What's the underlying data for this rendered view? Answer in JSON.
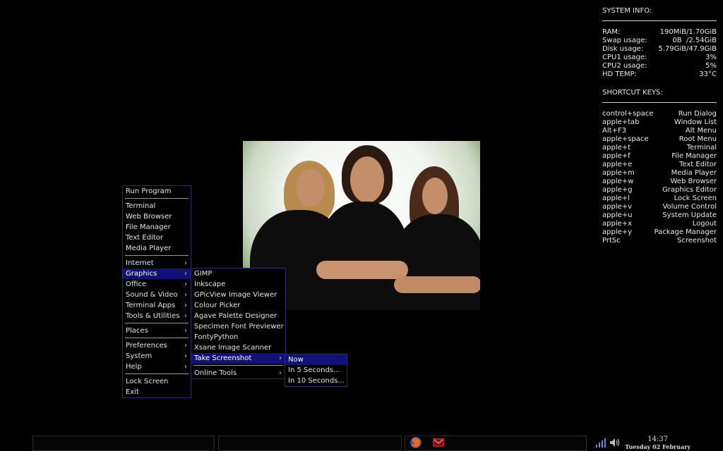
{
  "conky": {
    "system_title": "SYSTEM INFO:",
    "stats": [
      {
        "label": "RAM:",
        "value": "190MiB/1.70GiB"
      },
      {
        "label": "Swap usage:",
        "value": "0B  /2.54GiB"
      },
      {
        "label": "Disk usage:",
        "value": "5.79GiB/47.9GiB"
      },
      {
        "label": "CPU1 usage:",
        "value": "3%"
      },
      {
        "label": "CPU2 usage:",
        "value": "5%"
      },
      {
        "label": "HD TEMP:",
        "value": "33°C"
      }
    ],
    "shortcut_title": "SHORTCUT KEYS:",
    "shortcuts": [
      {
        "key": "control+space",
        "action": "Run Dialog"
      },
      {
        "key": "apple+tab",
        "action": "Window List"
      },
      {
        "key": "Alt+F3",
        "action": "Alt Menu"
      },
      {
        "key": "apple+space",
        "action": "Root Menu"
      },
      {
        "key": "apple+t",
        "action": "Terminal"
      },
      {
        "key": "apple+f",
        "action": "File Manager"
      },
      {
        "key": "apple+e",
        "action": "Text Editor"
      },
      {
        "key": "apple+m",
        "action": "Media Player"
      },
      {
        "key": "apple+w",
        "action": "Web Browser"
      },
      {
        "key": "apple+g",
        "action": "Graphics Editor"
      },
      {
        "key": "apple+l",
        "action": "Lock Screen"
      },
      {
        "key": "apple+v",
        "action": "Volume Control"
      },
      {
        "key": "apple+u",
        "action": "System Update"
      },
      {
        "key": "apple+x",
        "action": "Logout"
      },
      {
        "key": "apple+y",
        "action": "Package Manager"
      },
      {
        "key": "PrtSc",
        "action": "Screenshot"
      }
    ]
  },
  "root_menu": {
    "run_program": "Run Program",
    "apps": [
      "Terminal",
      "Web Browser",
      "File Manager",
      "Text Editor",
      "Media Player"
    ],
    "categories": [
      "Internet",
      "Graphics",
      "Office",
      "Sound & Video",
      "Terminal Apps",
      "Tools & Utilities"
    ],
    "places": "Places",
    "system_items": [
      "Preferences",
      "System",
      "Help"
    ],
    "lock": "Lock Screen",
    "exit": "Exit"
  },
  "graphics_menu": {
    "items": [
      "GIMP",
      "Inkscape",
      "GPicView Image Viewer",
      "Colour Picker",
      "Agave Palette Designer",
      "Specimen Font Previewer",
      "FontyPython",
      "Xsane Image Scanner"
    ],
    "take_screenshot": "Take Screenshot",
    "online_tools": "Online Tools"
  },
  "screenshot_menu": {
    "items": [
      "Now",
      "In 5 Seconds...",
      "In 10 Seconds..."
    ]
  },
  "taskbar": {
    "time": "14:37",
    "date": "Tuesday 02 February",
    "launchers": [
      "firefox-icon",
      "mail-icon"
    ],
    "tray": [
      "network-signal-icon",
      "volume-icon"
    ]
  },
  "icons": {
    "submenu_arrow": "›"
  },
  "colors": {
    "menu_highlight": "#10127a",
    "menu_border": "#27306a"
  }
}
